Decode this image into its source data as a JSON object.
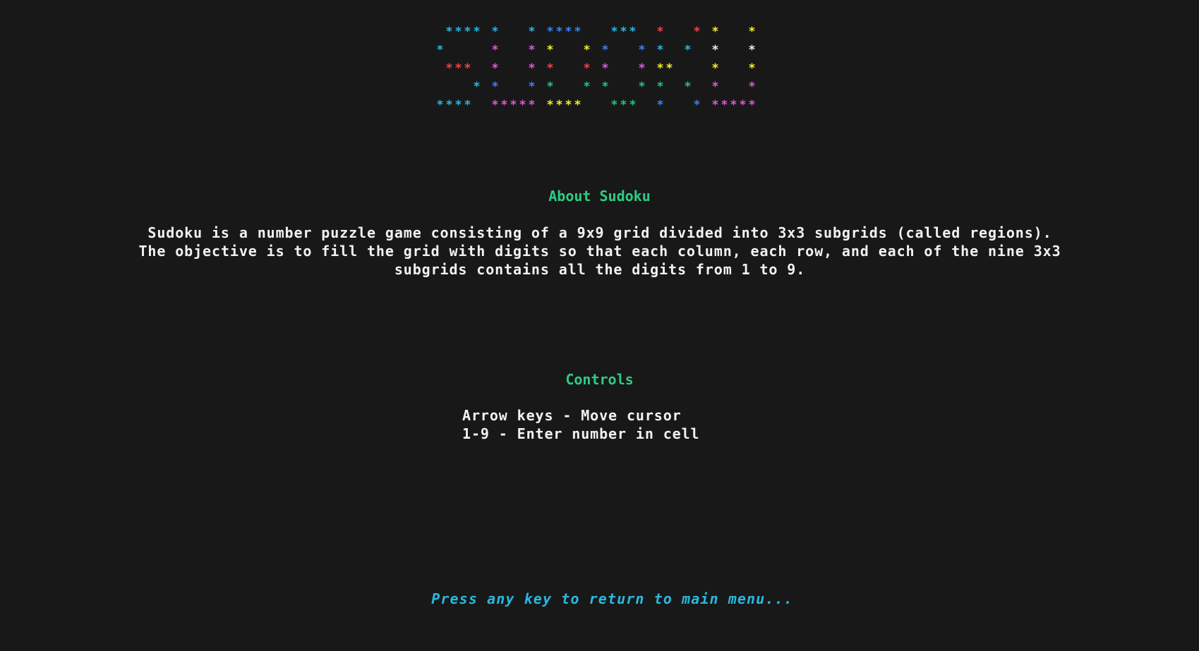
{
  "logo": {
    "glyph": "*",
    "colors": {
      "cyan": "#2bb5e6",
      "blue": "#3b82f6",
      "magenta": "#e05ad8",
      "red": "#ef4444",
      "yellow": "#f5ee2a",
      "green": "#22c77a",
      "white": "#f0f0f0"
    },
    "rows": [
      [
        [
          "cyan",
          1
        ],
        [
          "cyan",
          2
        ],
        [
          "cyan",
          3
        ],
        [
          "cyan",
          4
        ],
        [
          "cyan",
          6
        ],
        [
          "cyan",
          10
        ],
        [
          "blue",
          12
        ],
        [
          "blue",
          13
        ],
        [
          "blue",
          14
        ],
        [
          "blue",
          15
        ],
        [
          "cyan",
          19
        ],
        [
          "cyan",
          20
        ],
        [
          "cyan",
          21
        ],
        [
          "red",
          24
        ],
        [
          "red",
          28
        ],
        [
          "yellow",
          30
        ],
        [
          "yellow",
          34
        ]
      ],
      [
        [
          "cyan",
          0
        ],
        [
          "magenta",
          6
        ],
        [
          "magenta",
          10
        ],
        [
          "yellow",
          12
        ],
        [
          "yellow",
          16
        ],
        [
          "blue",
          18
        ],
        [
          "blue",
          22
        ],
        [
          "cyan",
          24
        ],
        [
          "cyan",
          27
        ],
        [
          "white",
          30
        ],
        [
          "white",
          34
        ]
      ],
      [
        [
          "red",
          1
        ],
        [
          "red",
          2
        ],
        [
          "red",
          3
        ],
        [
          "magenta",
          6
        ],
        [
          "magenta",
          10
        ],
        [
          "red",
          12
        ],
        [
          "red",
          16
        ],
        [
          "magenta",
          18
        ],
        [
          "magenta",
          22
        ],
        [
          "yellow",
          24
        ],
        [
          "yellow",
          25
        ],
        [
          "yellow",
          30
        ],
        [
          "yellow",
          34
        ]
      ],
      [
        [
          "cyan",
          4
        ],
        [
          "blue",
          6
        ],
        [
          "blue",
          10
        ],
        [
          "green",
          12
        ],
        [
          "green",
          16
        ],
        [
          "green",
          18
        ],
        [
          "green",
          22
        ],
        [
          "green",
          24
        ],
        [
          "green",
          27
        ],
        [
          "magenta",
          30
        ],
        [
          "magenta",
          34
        ]
      ],
      [
        [
          "cyan",
          0
        ],
        [
          "cyan",
          1
        ],
        [
          "cyan",
          2
        ],
        [
          "cyan",
          3
        ],
        [
          "magenta",
          6
        ],
        [
          "magenta",
          7
        ],
        [
          "magenta",
          8
        ],
        [
          "magenta",
          9
        ],
        [
          "magenta",
          10
        ],
        [
          "yellow",
          12
        ],
        [
          "yellow",
          13
        ],
        [
          "yellow",
          14
        ],
        [
          "yellow",
          15
        ],
        [
          "green",
          19
        ],
        [
          "green",
          20
        ],
        [
          "green",
          21
        ],
        [
          "blue",
          24
        ],
        [
          "blue",
          28
        ],
        [
          "magenta",
          30
        ],
        [
          "magenta",
          31
        ],
        [
          "magenta",
          32
        ],
        [
          "magenta",
          33
        ],
        [
          "magenta",
          34
        ]
      ]
    ]
  },
  "about": {
    "title": "About Sudoku",
    "lines": [
      "Sudoku is a number puzzle game consisting of a 9x9 grid divided into 3x3 subgrids (called regions).",
      "The objective is to fill the grid with digits so that each column, each row, and each of the nine 3x3",
      "subgrids contains all the digits from 1 to 9."
    ]
  },
  "controls": {
    "title": "Controls",
    "items": [
      "Arrow keys - Move cursor",
      "1-9 - Enter number in cell"
    ]
  },
  "footer": {
    "prompt": "Press any key to return to main menu..."
  }
}
